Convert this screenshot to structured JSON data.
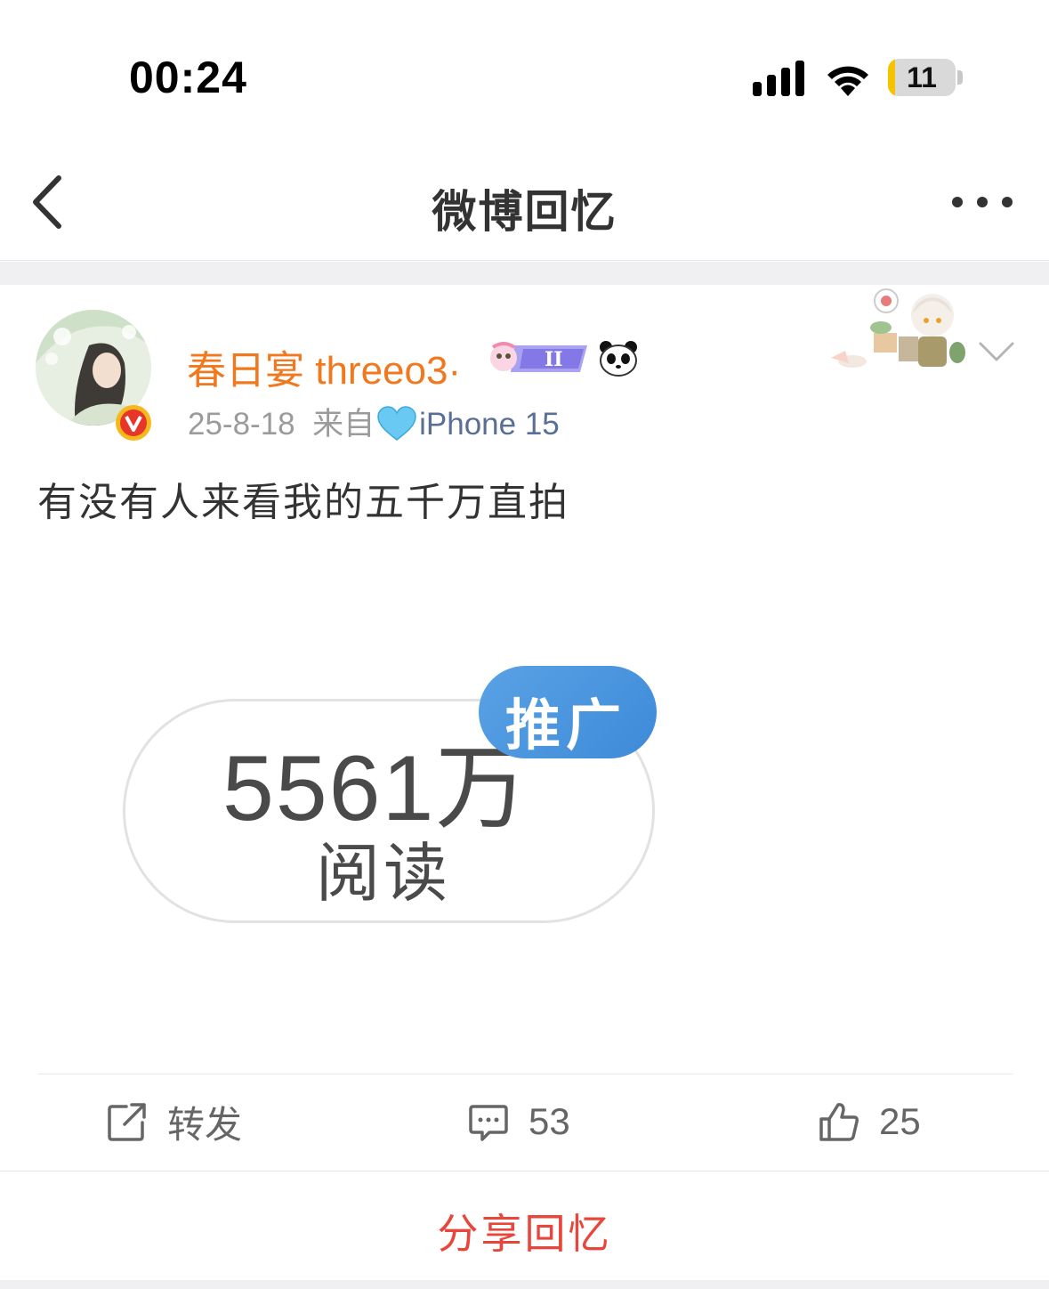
{
  "status_bar": {
    "time": "00:24",
    "battery_level": "11",
    "battery_fraction": 0.11,
    "signal_icon": "cellular-signal-icon",
    "wifi_icon": "wifi-icon"
  },
  "nav": {
    "title": "微博回忆",
    "back_icon": "chevron-left-icon",
    "more_icon": "ellipsis-icon"
  },
  "post": {
    "username": "春日宴 threeo3·",
    "date": "25-8-18",
    "source_prefix": "来自",
    "source": "iPhone 15",
    "text": "有没有人来看我的五千万直拍",
    "image": {
      "count": "5561万",
      "label": "阅读",
      "tag": "推广"
    },
    "actions": {
      "repost_label": "转发",
      "comment_count": "53",
      "like_count": "25"
    }
  },
  "footer": {
    "share_label": "分享回忆"
  },
  "colors": {
    "username": "#f0781e",
    "source": "#5a6f96",
    "share": "#e8463a",
    "promo": "#3d8ad8",
    "battery": "#f5c400"
  }
}
